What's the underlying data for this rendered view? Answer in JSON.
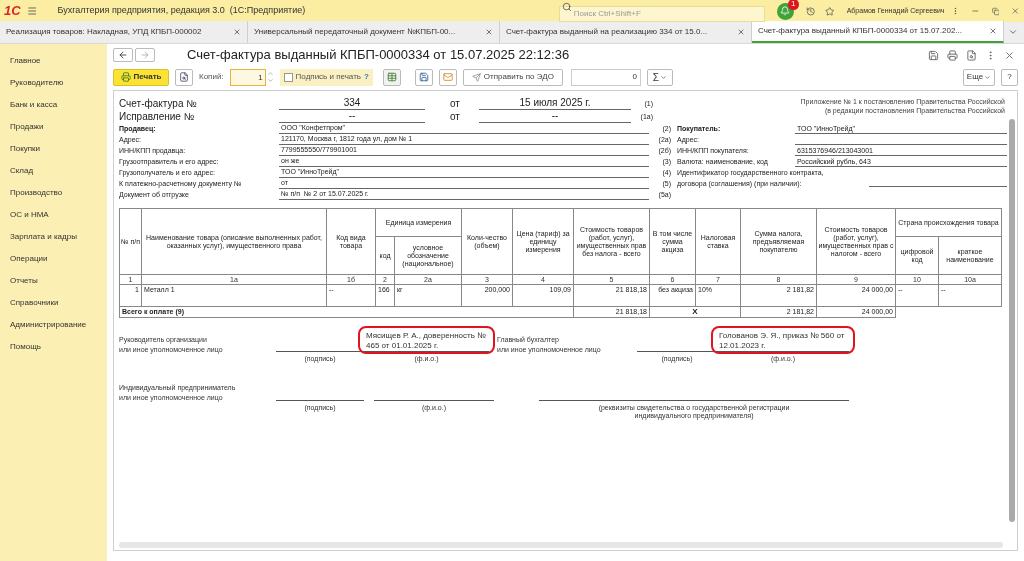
{
  "app": {
    "logo": "1С",
    "title": "Бухгалтерия предприятия, редакция 3.0  (1С:Предприятие)",
    "search_placeholder": "Поиск Ctrl+Shift+F",
    "notifications": "1",
    "user": "Абрамов Геннадий Сергеевич"
  },
  "tabs": [
    {
      "label": "Реализация товаров: Накладная, УПД КПБП-000002",
      "selected": false
    },
    {
      "label": "Универсальный передаточный документ №КПБП-00...",
      "selected": false
    },
    {
      "label": "Счет-фактура выданный на реализацию 334 от 15.0...",
      "selected": false
    },
    {
      "label": "Счет-фактура выданный КПБП-0000334 от 15.07.202...",
      "selected": true
    }
  ],
  "sidebar": {
    "items": [
      "Главное",
      "Руководителю",
      "Банк и касса",
      "Продажи",
      "Покупки",
      "Склад",
      "Производство",
      "ОС и НМА",
      "Зарплата и кадры",
      "Операции",
      "Отчеты",
      "Справочники",
      "Администрирование",
      "Помощь"
    ]
  },
  "form": {
    "title": "Счет-фактура выданный КПБП-0000334 от 15.07.2025 22:12:36",
    "toolbar": {
      "print": "Печать",
      "copies_label": "Копий:",
      "copies": "1",
      "sign_and_print": {
        "label": "Подпись и печать",
        "checked": false
      },
      "sign_help": "?",
      "send_edo": "Отправить по ЭДО",
      "amount": "0",
      "sum": "Σ",
      "more": "Еще",
      "help": "?"
    }
  },
  "document": {
    "appendix_lines": [
      "Приложение № 1 к постановлению Правительства Российской",
      "(в редакции постановления Правительства Российской"
    ],
    "header_rows": [
      {
        "label": "Счет-фактура №",
        "number": "334",
        "from": "от",
        "date": "15 июля 2025 г.",
        "code": "(1)"
      },
      {
        "label": "Исправление №",
        "number": "--",
        "from": "от",
        "date": "--",
        "code": "(1а)"
      }
    ],
    "seller_rows": [
      {
        "label": "Продавец:",
        "value": "ООО \"Конфетпром\"",
        "code": "(2)",
        "bold": true
      },
      {
        "label": "Адрес:",
        "value": "121170, Москва г, 1812 года ул, дом № 1",
        "code": "(2а)",
        "bold": false
      },
      {
        "label": "ИНН/КПП продавца:",
        "value": "7799555550/779901001",
        "code": "(2б)",
        "bold": false
      },
      {
        "label": "Грузоотправитель и его адрес:",
        "value": "он же",
        "code": "(3)",
        "bold": false
      },
      {
        "label": "Грузополучатель и его адрес:",
        "value": "ТОО \"ИнноТрейд\"",
        "code": "(4)",
        "bold": false
      },
      {
        "label": "К платежно-расчетному документу №",
        "value": "от",
        "code": "(5)",
        "bold": false
      },
      {
        "label": "Документ об отгрузке",
        "value": "№ п/п  № 2 от 15.07.2025 г.",
        "code": "(5а)",
        "bold": false
      }
    ],
    "buyer_rows": [
      {
        "kind": "line",
        "label": "Покупатель:",
        "value": "ТОО \"ИнноТрейд\"",
        "bold": true
      },
      {
        "kind": "line",
        "label": "Адрес:",
        "bold": false
      },
      {
        "kind": "line",
        "label": "ИНН/КПП покупателя:",
        "value": "6315376946/213043001",
        "bold": false
      },
      {
        "kind": "line",
        "label": "Валюта: наименование, код",
        "value": "Российский рубль, 643",
        "bold": false
      },
      {
        "kind": "contract",
        "label_lines": [
          "Идентификатор государственного контракта,",
          "договора (соглашения) (при наличии):"
        ],
        "bold": false
      }
    ],
    "table": {
      "column_groups": [
        "Единица измерения",
        "Страна происхождения товара"
      ],
      "columns": [
        {
          "kind": "column",
          "title": "№ п/п",
          "number": "1"
        },
        {
          "kind": "column",
          "title": "Наименование товара (описание выполненных работ, оказанных услуг), имущественного права",
          "number": "1а"
        },
        {
          "kind": "column",
          "title": "Код вида товара",
          "number": "1б"
        },
        {
          "kind": "subcolumn",
          "title": "код",
          "number": "2"
        },
        {
          "kind": "subcolumn",
          "title": "условное обозначение (национальное)",
          "number": "2а"
        },
        {
          "kind": "column",
          "title": "Коли-чество (объем)",
          "number": "3"
        },
        {
          "kind": "column",
          "title": "Цена (тариф) за единицу измерения",
          "number": "4"
        },
        {
          "kind": "column",
          "title": "Стоимость товаров (работ, услуг), имущественных прав без налога - всего",
          "number": "5"
        },
        {
          "kind": "column",
          "title": "В том числе сумма акциза",
          "number": "6"
        },
        {
          "kind": "column",
          "title": "Налоговая ставка",
          "number": "7"
        },
        {
          "kind": "column",
          "title": "Сумма налога, предъявляемая покупателю",
          "number": "8"
        },
        {
          "kind": "column",
          "title": "Стоимость товаров (работ, услуг), имущественных прав с налогом - всего",
          "number": "9"
        },
        {
          "kind": "subcolumn",
          "title": "цифровой код",
          "number": "10"
        },
        {
          "kind": "subcolumn",
          "title": "краткое наименование",
          "number": "10а"
        }
      ],
      "rows": [
        [
          "1",
          "Металл 1",
          "--",
          "166",
          "кг",
          "200,000",
          "109,09",
          "21 818,18",
          "без акциза",
          "10%",
          "2 181,82",
          "24 000,00",
          "--",
          "--"
        ]
      ],
      "total": {
        "label": "Всего к оплате (9)",
        "cost_without_tax": "21 818,18",
        "excise": "Х",
        "tax": "2 181,82",
        "cost_with_tax": "24 000,00"
      }
    },
    "signatures": {
      "signers": [
        {
          "label_lines": [
            "Руководитель организации",
            "или иное уполномоченное лицо"
          ],
          "sign_caption": "(подпись)",
          "fio": "Мясищев Р. А., доверенность № 465 от 01.01.2025 г.",
          "fio_caption": "(ф.и.о.)",
          "highlighted": true
        },
        {
          "label_lines": [
            "Главный бухгалтер",
            "или иное уполномоченное лицо"
          ],
          "sign_caption": "(подпись)",
          "fio": "Голованов Э. Я., приказ № 560 от 12.01.2023 г.",
          "fio_caption": "(ф.и.о.)",
          "highlighted": true
        }
      ],
      "entrepreneur": {
        "label_lines": [
          "Индивидуальный предприниматель",
          "или иное уполномоченное лицо"
        ],
        "sign_caption": "(подпись)",
        "fio_caption": "(ф.и.о.)",
        "registration_caption": "(реквизиты свидетельства о государственной регистрации индивидуального предпринимателя)"
      }
    }
  }
}
